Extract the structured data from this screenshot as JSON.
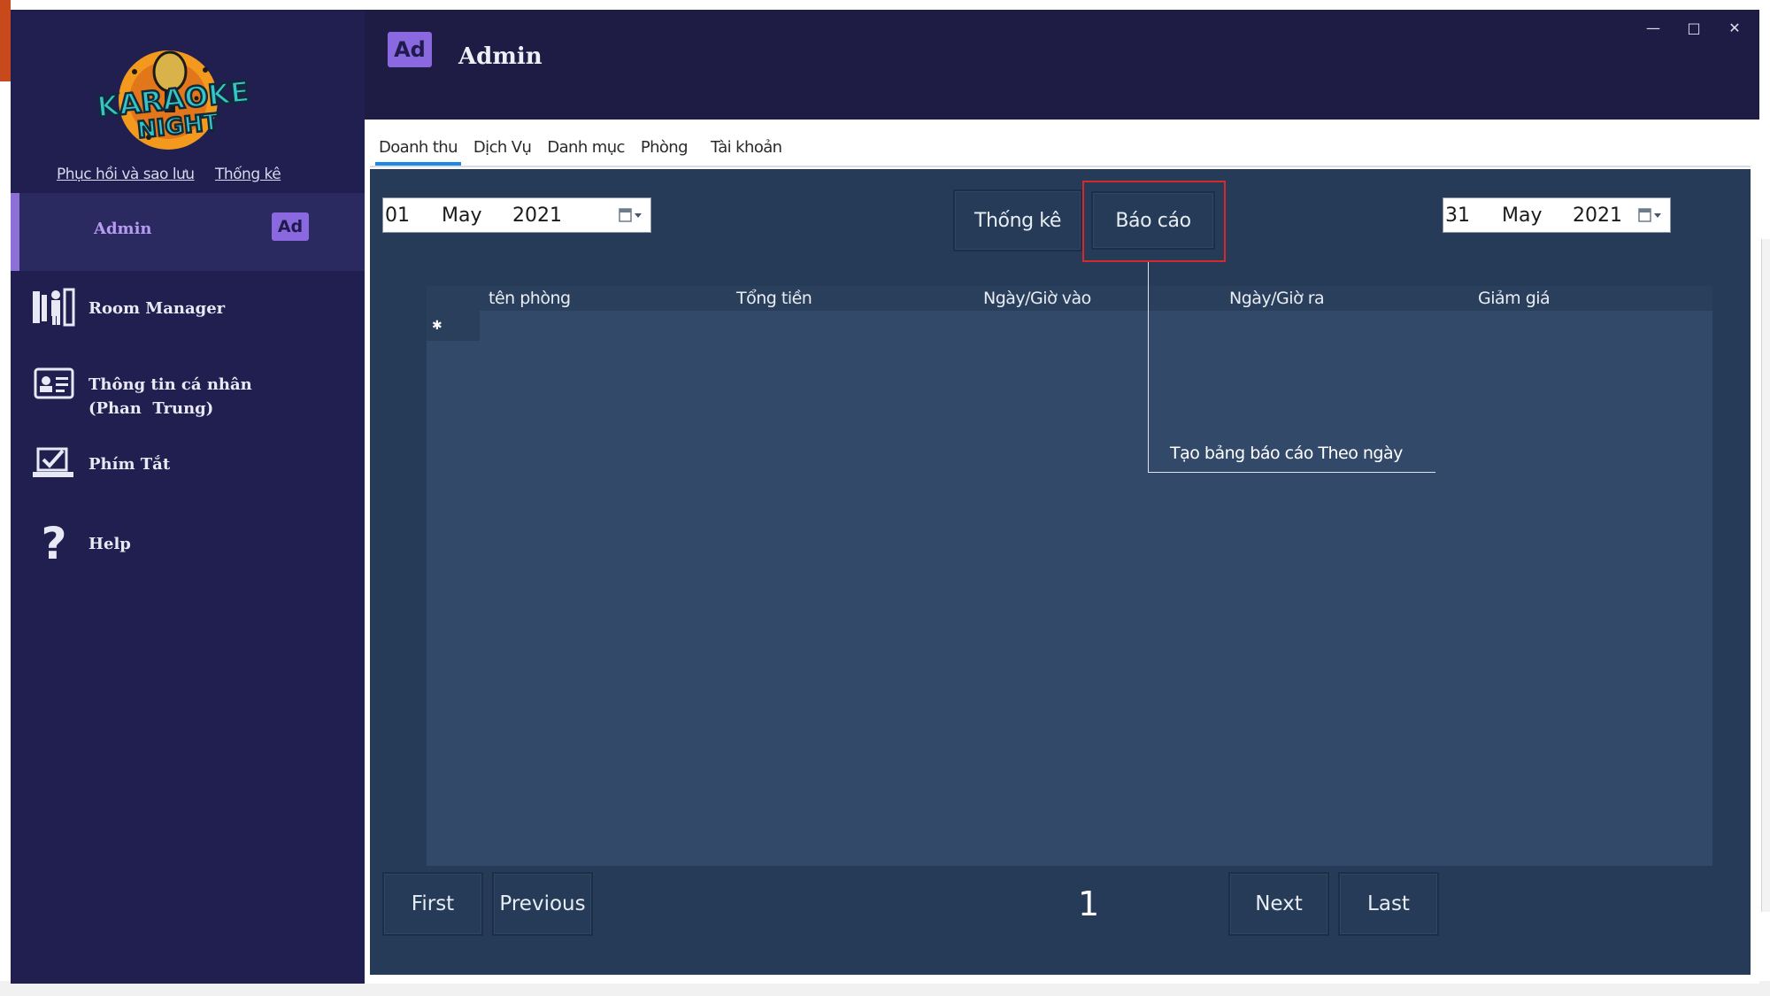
{
  "window": {
    "controls": {
      "minimize": "—",
      "maximize": "□",
      "close": "✕"
    }
  },
  "sidebar": {
    "logo": {
      "line1": "KARAOKE",
      "line2": "NIGHT"
    },
    "links": [
      "Phục hồi và sao lưu",
      "Thống kê"
    ],
    "admin": {
      "label": "Admin",
      "badge": "Ad"
    },
    "items": [
      {
        "label": "Room Manager",
        "icon": "room-manager-icon"
      },
      {
        "label": "Thông tin cá nhân\n(Phan  Trung)",
        "icon": "id-card-icon"
      },
      {
        "label": "Phím Tắt",
        "icon": "shortcut-laptop-icon"
      },
      {
        "label": "Help",
        "icon": "question-mark-icon"
      }
    ]
  },
  "header": {
    "badge": "Ad",
    "title": "Admin"
  },
  "tabs": [
    {
      "label": "Doanh thu",
      "active": true
    },
    {
      "label": "Dịch Vụ",
      "active": false
    },
    {
      "label": "Danh mục",
      "active": false
    },
    {
      "label": "Phòng",
      "active": false
    },
    {
      "label": "Tài khoản",
      "active": false
    }
  ],
  "filters": {
    "from_date": {
      "day": "01",
      "month": "May",
      "year": "2021"
    },
    "to_date": {
      "day": "31",
      "month": "May",
      "year": "2021"
    },
    "stats_button": "Thống kê",
    "report_button": "Báo cáo"
  },
  "grid": {
    "columns": [
      "tên phòng",
      "Tổng tiền",
      "Ngày/Giờ vào",
      "Ngày/Giờ ra",
      "Giảm giá"
    ],
    "row_indicator": "✱",
    "rows": []
  },
  "annotation": {
    "text": "Tạo bảng báo cáo Theo ngày",
    "highlight_color": "#d7282c"
  },
  "pager": {
    "first": "First",
    "previous": "Previous",
    "page": "1",
    "next": "Next",
    "last": "Last"
  },
  "colors": {
    "sidebar": "#201f4f",
    "panel": "#253b57",
    "grid": "#33496a",
    "accent": "#8a68e0",
    "tab_indicator": "#1e88e5"
  }
}
